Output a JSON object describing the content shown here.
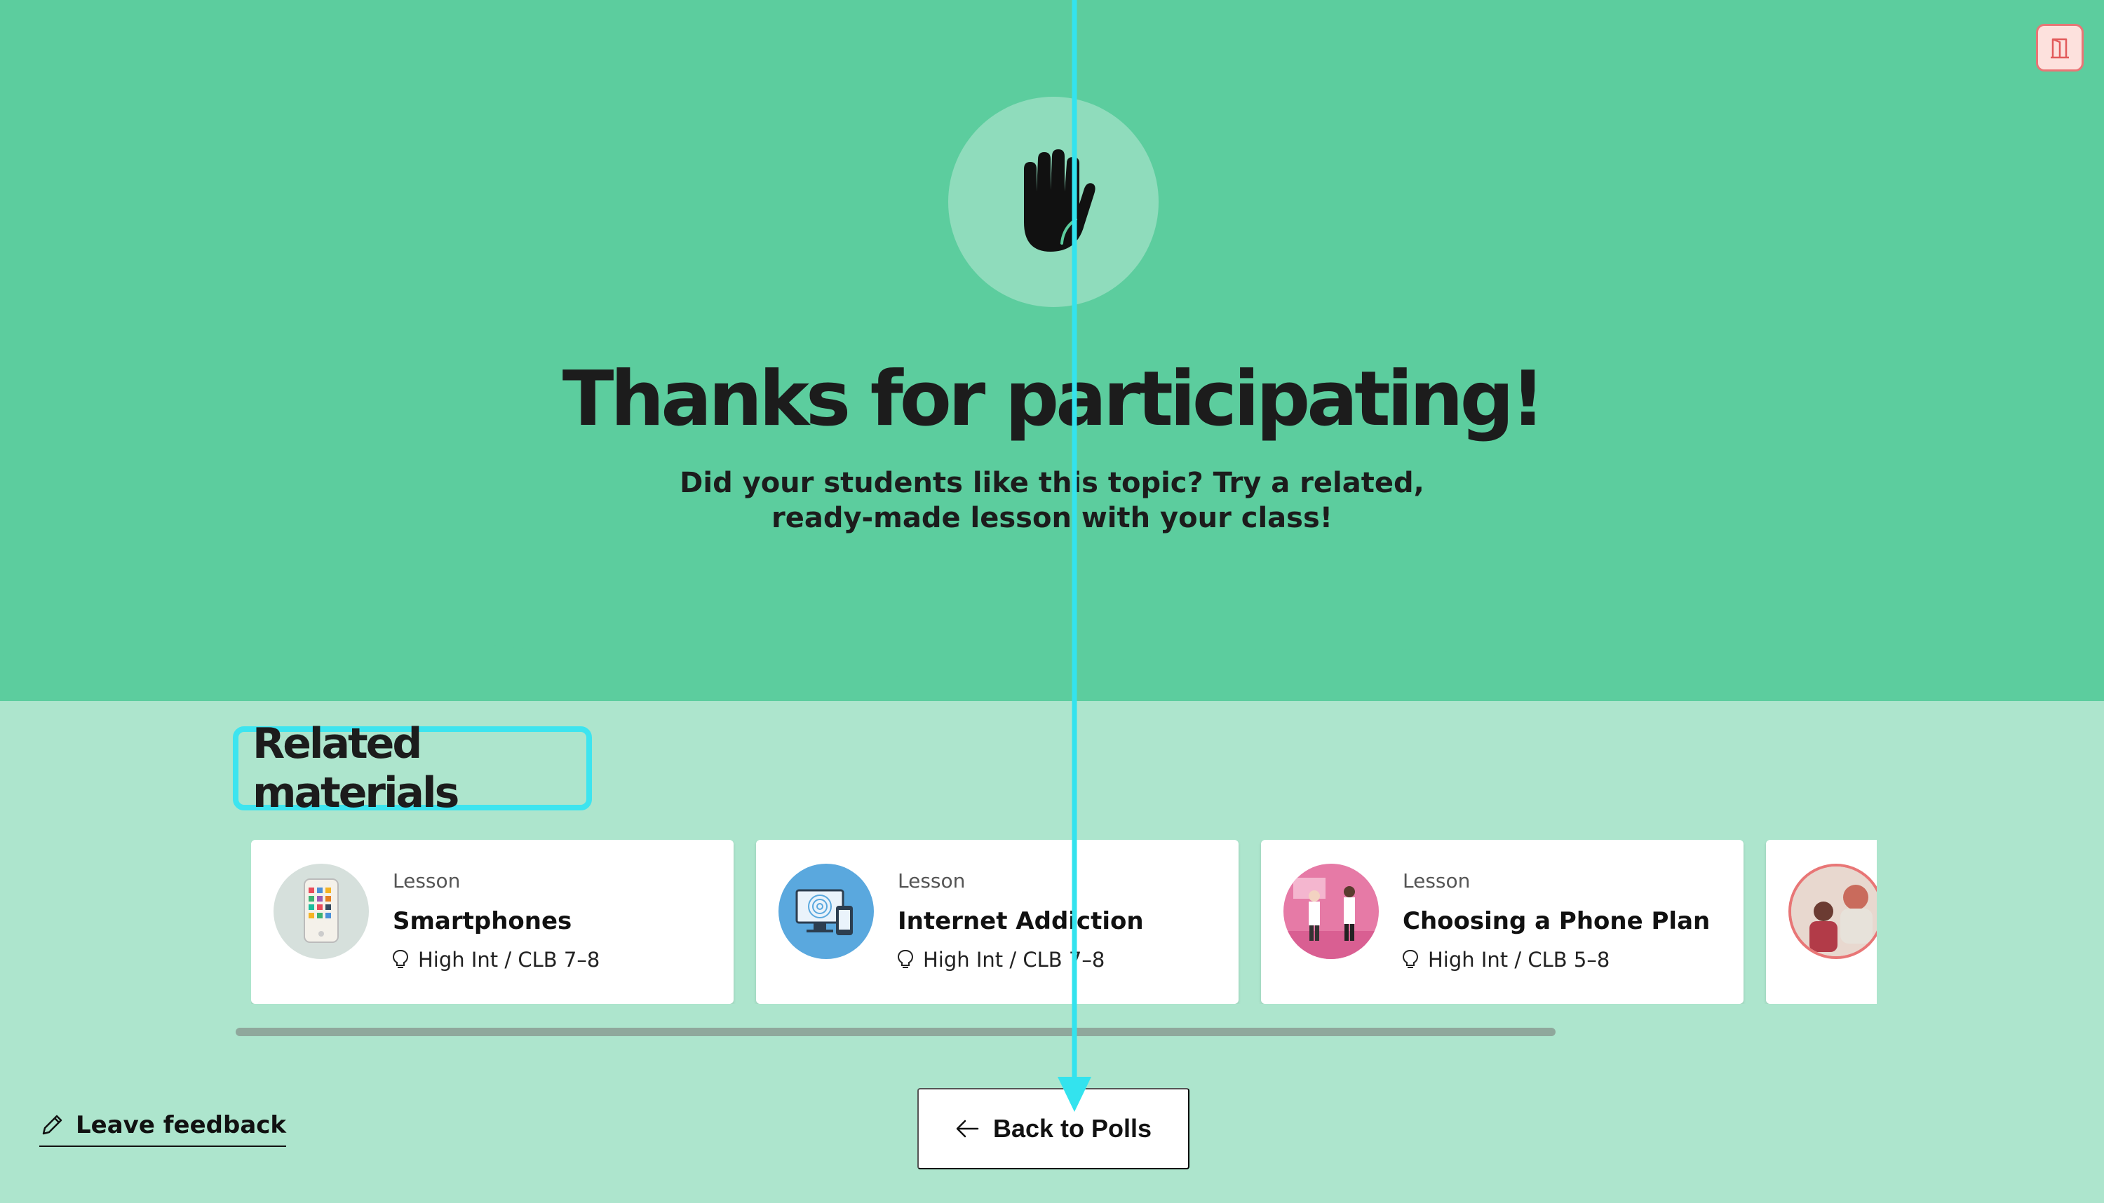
{
  "header": {
    "exit_icon": "exit-door-icon",
    "hero_icon": "raised-hand-icon"
  },
  "main": {
    "title": "Thanks for participating!",
    "subtitle": "Did your students like this topic? Try a related, ready-made lesson with your class!"
  },
  "related": {
    "heading": "Related materials",
    "items": [
      {
        "type": "Lesson",
        "title": "Smartphones",
        "level": "High Int / CLB 7–8",
        "thumb_color": "#d6e0dc"
      },
      {
        "type": "Lesson",
        "title": "Internet Addiction",
        "level": "High Int / CLB 7–8",
        "thumb_color": "#5aa8de"
      },
      {
        "type": "Lesson",
        "title": "Choosing a Phone Plan",
        "level": "High Int / CLB 5–8",
        "thumb_color": "#e67aa6"
      },
      {
        "type": "",
        "title": "",
        "level": "",
        "thumb_color": "#f0d6d0"
      }
    ]
  },
  "footer": {
    "feedback_label": "Leave feedback",
    "back_label": "Back to Polls"
  },
  "colors": {
    "hero_bg": "#5ccd9e",
    "lower_bg": "#ade5cd",
    "highlight": "#3de4ef",
    "annotation": "#33e3ee"
  }
}
